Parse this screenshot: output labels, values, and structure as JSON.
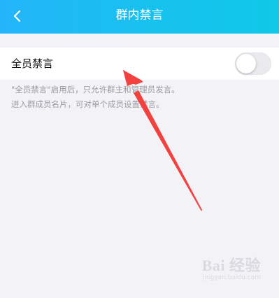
{
  "header": {
    "title": "群内禁言",
    "back_icon": "chevron-left-icon"
  },
  "setting": {
    "label": "全员禁言",
    "toggle_on": false
  },
  "description": {
    "line1": "\"全员禁言\"启用后，只允许群主和管理员发言。",
    "line2": "进入群成员名片，可对单个成员设置禁言。"
  },
  "annotation": {
    "color": "#f2413f"
  },
  "watermark": {
    "logo": "Bai 经验",
    "url": "jingyan.baidu.com"
  }
}
